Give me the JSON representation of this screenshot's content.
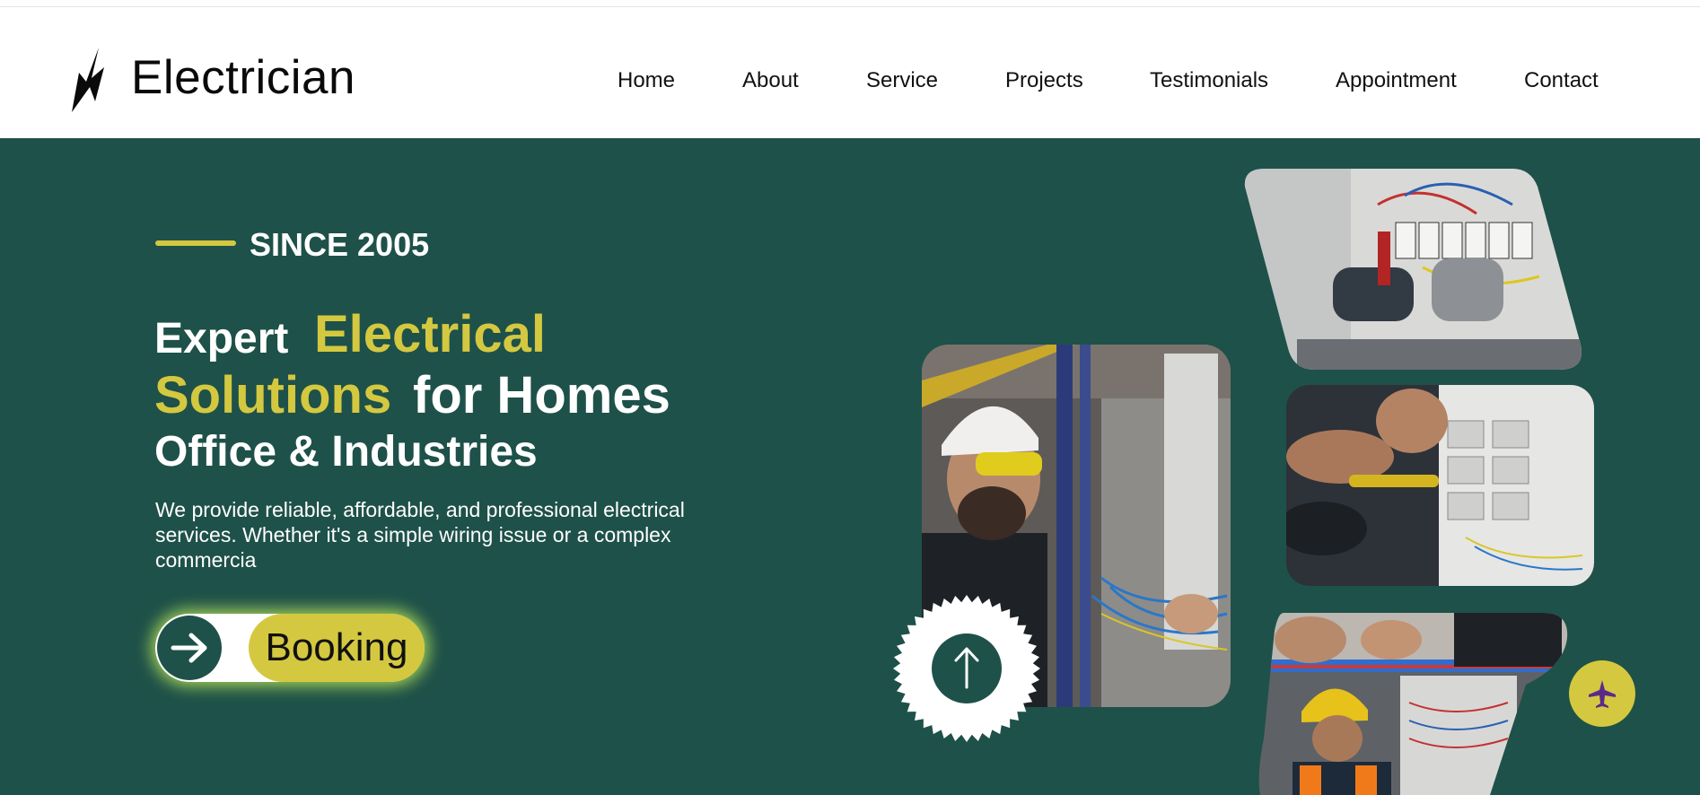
{
  "header": {
    "brand": "Electrician",
    "logo_icon": "lightning-bolt-icon"
  },
  "nav": {
    "items": [
      {
        "label": "Home"
      },
      {
        "label": "About"
      },
      {
        "label": "Service"
      },
      {
        "label": "Projects"
      },
      {
        "label": "Testimonials"
      },
      {
        "label": "Appointment"
      },
      {
        "label": "Contact"
      }
    ]
  },
  "hero": {
    "since": "SINCE 2005",
    "headline": {
      "line1_a": "Expert",
      "line1_b": "Electrical",
      "line2_a": "Solutions",
      "line2_b": "for Homes",
      "line3": "Office & Industries"
    },
    "description": "We provide reliable, affordable, and professional electrical services. Whether it's a simple wiring issue or a complex commercia",
    "booking_label": "Booking",
    "booking_icon": "arrow-right-icon"
  },
  "floating": {
    "scroll_top_icon": "arrow-up-icon",
    "action_icon": "airplane-icon"
  },
  "colors": {
    "brand_green": "#1e5149",
    "accent_yellow": "#d4c840",
    "glow": "#c4f05a",
    "plane_purple": "#5a2a8a"
  }
}
